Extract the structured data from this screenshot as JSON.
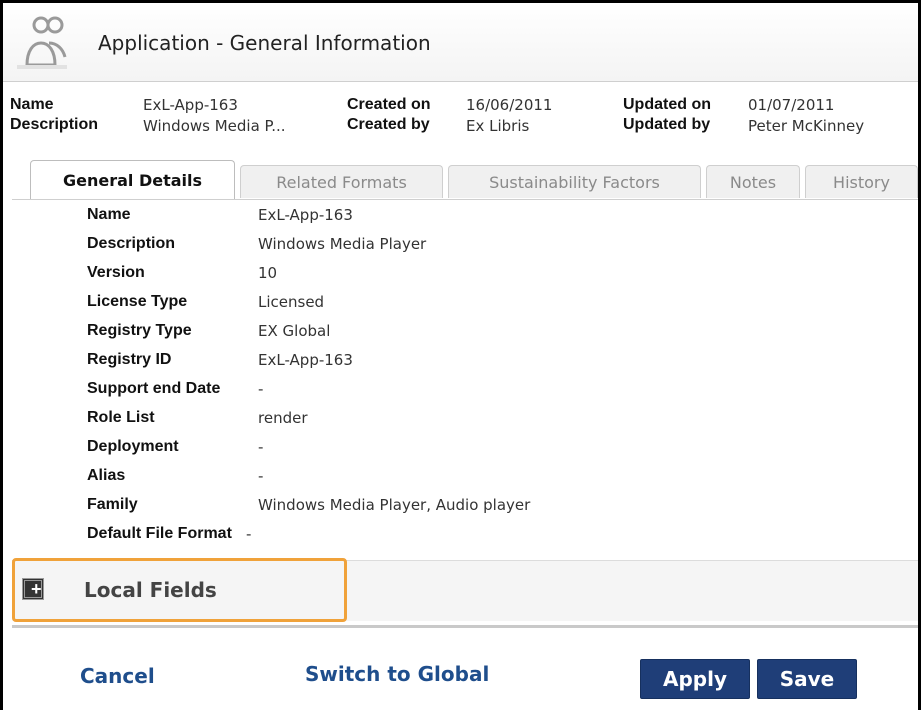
{
  "window": {
    "title": "Application - General Information"
  },
  "header": {
    "name_label": "Name",
    "name_value": "ExL-App-163",
    "description_label": "Description",
    "description_value": "Windows Media P...",
    "created_on_label": "Created on",
    "created_on_value": "16/06/2011",
    "created_by_label": "Created by",
    "created_by_value": "Ex Libris",
    "updated_on_label": "Updated on",
    "updated_on_value": "01/07/2011",
    "updated_by_label": "Updated by",
    "updated_by_value": "Peter McKinney"
  },
  "tabs": [
    {
      "label": "General Details",
      "active": true
    },
    {
      "label": "Related Formats",
      "active": false
    },
    {
      "label": "Sustainability Factors",
      "active": false
    },
    {
      "label": "Notes",
      "active": false
    },
    {
      "label": "History",
      "active": false
    }
  ],
  "details": [
    {
      "label": "Name",
      "value": "ExL-App-163"
    },
    {
      "label": "Description",
      "value": "Windows Media Player"
    },
    {
      "label": "Version",
      "value": "10"
    },
    {
      "label": "License Type",
      "value": "Licensed"
    },
    {
      "label": "Registry Type",
      "value": "EX Global"
    },
    {
      "label": "Registry ID",
      "value": "ExL-App-163"
    },
    {
      "label": "Support end Date",
      "value": "-"
    },
    {
      "label": "Role List",
      "value": "render"
    },
    {
      "label": "Deployment",
      "value": "-"
    },
    {
      "label": "Alias",
      "value": "-"
    },
    {
      "label": "Family",
      "value": "Windows Media Player, Audio player"
    },
    {
      "label": "Default File Format",
      "value": "-"
    }
  ],
  "local_fields": {
    "label": "Local Fields",
    "expand_symbol": "+"
  },
  "actions": {
    "cancel_label": "Cancel",
    "switch_label": "Switch to Global",
    "apply_label": "Apply",
    "save_label": "Save"
  },
  "colors": {
    "primary_button": "#1f3e78",
    "link": "#1f4e8c",
    "highlight": "#f0a23a"
  },
  "icons": {
    "title_icon": "users-icon"
  }
}
